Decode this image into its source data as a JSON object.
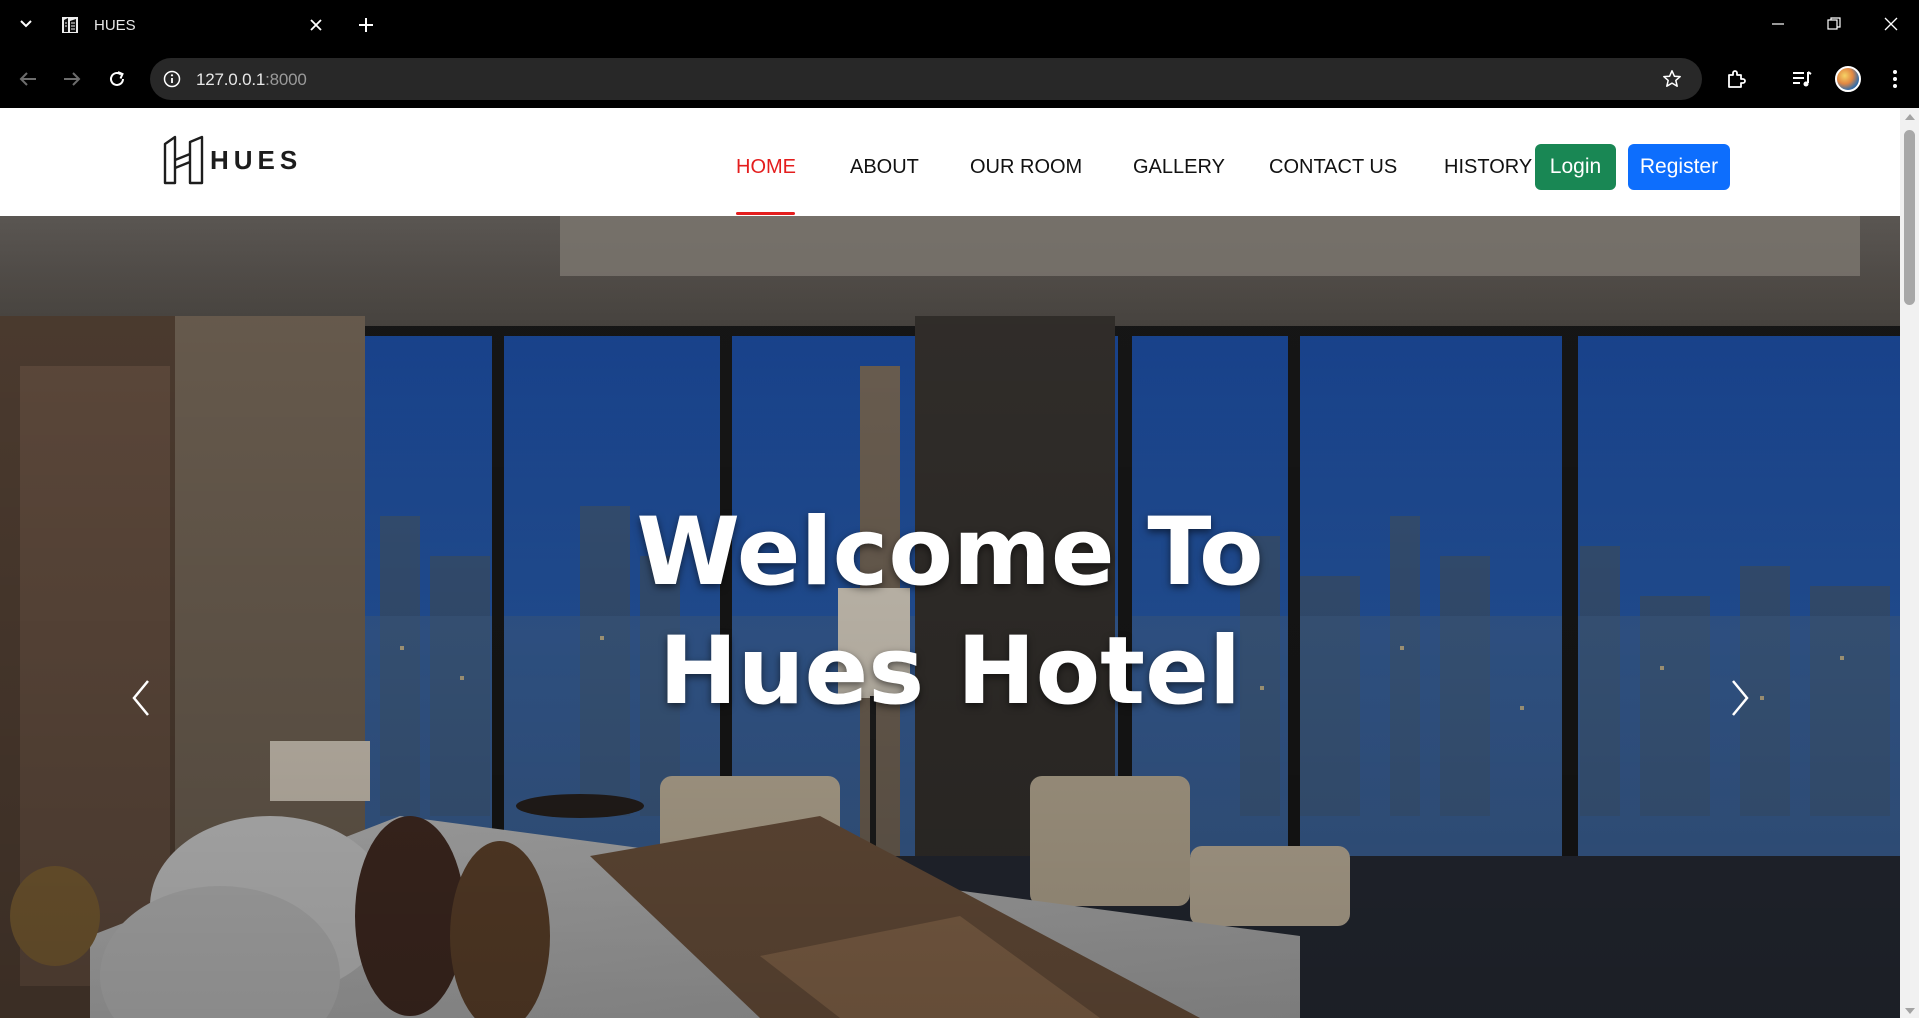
{
  "browser": {
    "tab_title": "HUES",
    "url_host": "127.0.0.1",
    "url_port": ":8000"
  },
  "site": {
    "logo_text": "HUES",
    "nav": [
      {
        "label": "HOME",
        "active": true
      },
      {
        "label": "ABOUT",
        "active": false
      },
      {
        "label": "OUR ROOM",
        "active": false
      },
      {
        "label": "GALLERY",
        "active": false
      },
      {
        "label": "CONTACT US",
        "active": false
      },
      {
        "label": "HISTORY",
        "active": false
      }
    ],
    "login_label": "Login",
    "register_label": "Register",
    "accent_color": "#e41e1e",
    "login_color": "#198754",
    "register_color": "#0d6efd"
  },
  "hero": {
    "title_line1": "Welcome To",
    "title_line2": "Hues Hotel"
  }
}
